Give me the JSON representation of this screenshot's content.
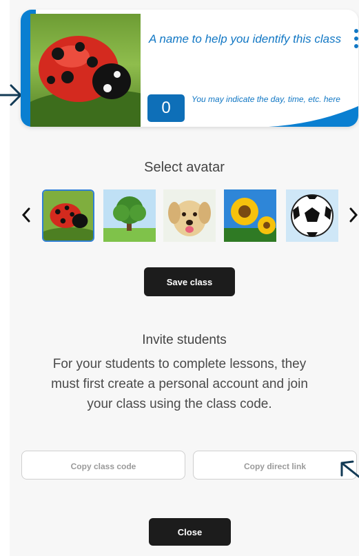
{
  "class_card": {
    "title": "A name to help you identify this class",
    "student_count": "0",
    "note": "You may indicate the day, time, etc. here",
    "menu_icon": "more-vertical-icon",
    "accent_color": "#1177c4",
    "badge_color": "#0e6fb8"
  },
  "avatar_section": {
    "heading": "Select avatar",
    "prev_icon": "chevron-left-icon",
    "next_icon": "chevron-right-icon",
    "avatars": [
      {
        "name": "ladybug",
        "selected": true
      },
      {
        "name": "tree",
        "selected": false
      },
      {
        "name": "puppy",
        "selected": false
      },
      {
        "name": "sunflowers",
        "selected": false
      },
      {
        "name": "soccer-ball",
        "selected": false
      }
    ],
    "save_label": "Save class"
  },
  "invite_section": {
    "heading": "Invite students",
    "body_lines": [
      "For your students to complete lessons, they",
      "must first create a personal account and join",
      "your class using the class code."
    ],
    "copy_code_label": "Copy class code",
    "copy_link_label": "Copy direct link"
  },
  "close_label": "Close"
}
